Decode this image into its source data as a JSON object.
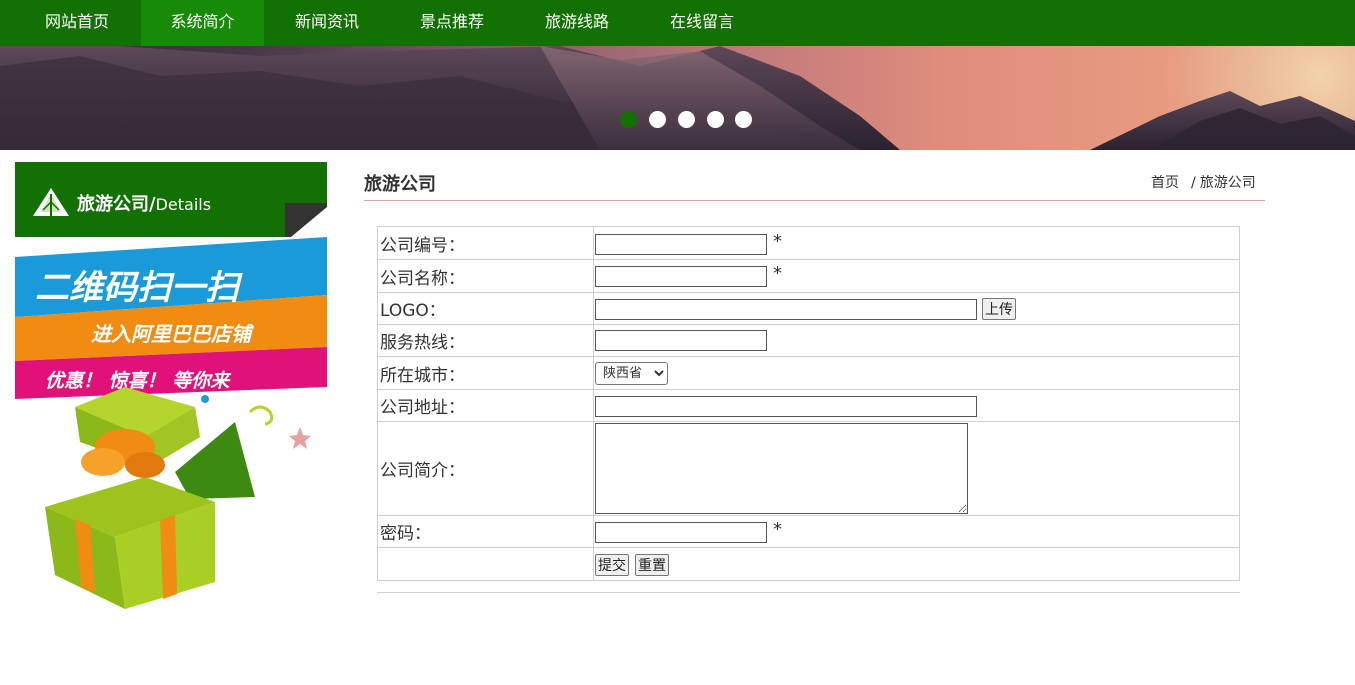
{
  "nav": {
    "items": [
      {
        "label": "网站首页"
      },
      {
        "label": "系统简介"
      },
      {
        "label": "新闻资讯"
      },
      {
        "label": "景点推荐"
      },
      {
        "label": "旅游线路"
      },
      {
        "label": "在线留言"
      }
    ],
    "active_index": 1
  },
  "banner": {
    "slides_count": 5,
    "active_slide": 1
  },
  "sidebar": {
    "title": "旅游公司/",
    "subtitle": "Details",
    "promo": {
      "line1": "二维码扫一扫",
      "line2": "进入阿里巴巴店铺",
      "line3": "优惠！ 惊喜！ 等你来"
    }
  },
  "content": {
    "title": "旅游公司",
    "breadcrumb": {
      "home": "首页",
      "separator": "/",
      "current": "旅游公司"
    }
  },
  "form": {
    "fields": {
      "company_no": {
        "label": "公司编号：",
        "value": "",
        "required": "*"
      },
      "company_name": {
        "label": "公司名称：",
        "value": "",
        "required": "*"
      },
      "logo": {
        "label": "LOGO：",
        "value": "",
        "upload_label": "上传"
      },
      "hotline": {
        "label": "服务热线：",
        "value": ""
      },
      "city": {
        "label": "所在城市：",
        "selected": "陕西省"
      },
      "address": {
        "label": "公司地址：",
        "value": ""
      },
      "intro": {
        "label": "公司简介：",
        "value": ""
      },
      "password": {
        "label": "密码：",
        "value": "",
        "required": "*"
      }
    },
    "submit_label": "提交",
    "reset_label": "重置"
  },
  "colors": {
    "brand_green": "#137003",
    "nav_active": "#178a08",
    "title_underline": "#e3a3a3"
  }
}
